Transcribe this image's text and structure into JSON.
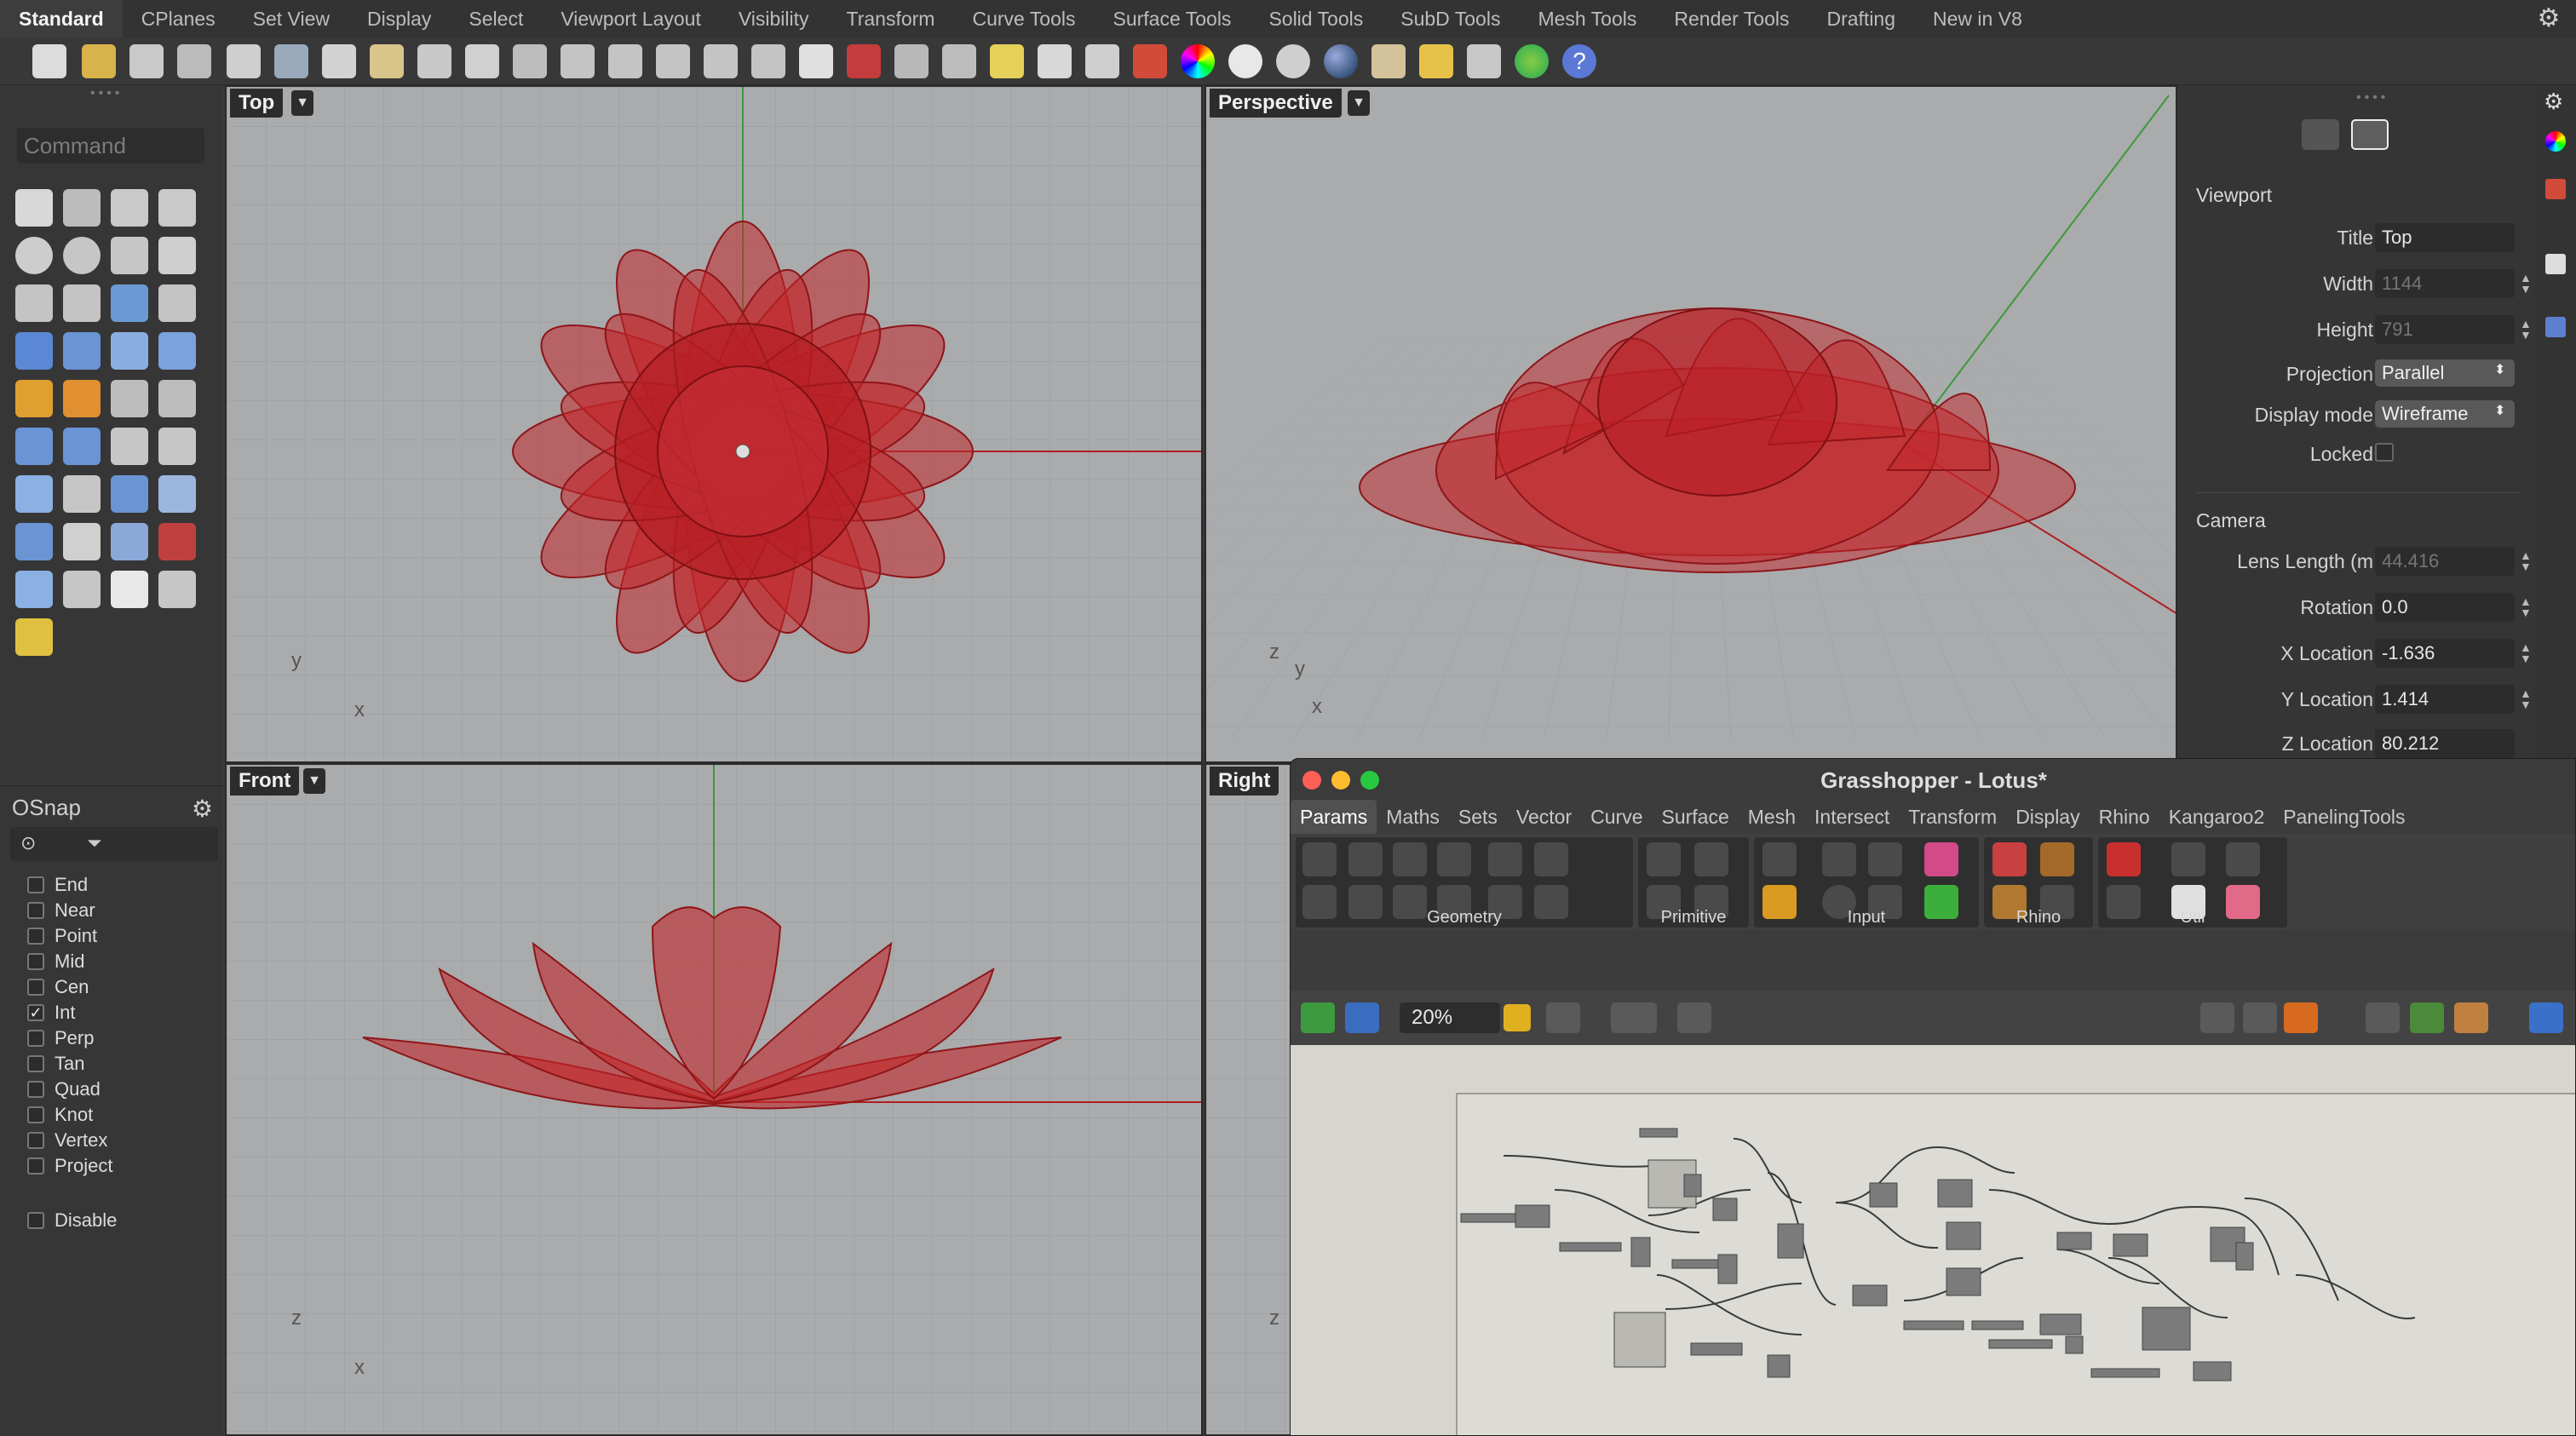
{
  "menu_tabs": [
    "Standard",
    "CPlanes",
    "Set View",
    "Display",
    "Select",
    "Viewport Layout",
    "Visibility",
    "Transform",
    "Curve Tools",
    "Surface Tools",
    "Solid Tools",
    "SubD Tools",
    "Mesh Tools",
    "Render Tools",
    "Drafting",
    "New in V8"
  ],
  "command_placeholder": "Command",
  "viewports": {
    "top": {
      "label": "Top",
      "axis_a": "y",
      "axis_b": "x"
    },
    "perspective": {
      "label": "Perspective",
      "axis_a": "z",
      "axis_b": "y",
      "axis_c": "x"
    },
    "front": {
      "label": "Front",
      "axis_a": "z",
      "axis_b": "x"
    },
    "right": {
      "label": "Right",
      "axis_a": "z"
    }
  },
  "osnap": {
    "title": "OSnap",
    "items": [
      {
        "label": "End",
        "checked": false
      },
      {
        "label": "Near",
        "checked": false
      },
      {
        "label": "Point",
        "checked": false
      },
      {
        "label": "Mid",
        "checked": false
      },
      {
        "label": "Cen",
        "checked": false
      },
      {
        "label": "Int",
        "checked": true
      },
      {
        "label": "Perp",
        "checked": false
      },
      {
        "label": "Tan",
        "checked": false
      },
      {
        "label": "Quad",
        "checked": false
      },
      {
        "label": "Knot",
        "checked": false
      },
      {
        "label": "Vertex",
        "checked": false
      },
      {
        "label": "Project",
        "checked": false
      }
    ],
    "disable_label": "Disable"
  },
  "properties": {
    "viewport_section": "Viewport",
    "title_label": "Title",
    "title_value": "Top",
    "width_label": "Width",
    "width_value": "1144",
    "height_label": "Height",
    "height_value": "791",
    "projection_label": "Projection",
    "projection_value": "Parallel",
    "display_mode_label": "Display mode",
    "display_mode_value": "Wireframe",
    "locked_label": "Locked",
    "camera_section": "Camera",
    "lens_label": "Lens Length (m",
    "lens_value": "44.416",
    "rotation_label": "Rotation",
    "rotation_value": "0.0",
    "xloc_label": "X Location",
    "xloc_value": "-1.636",
    "yloc_label": "Y Location",
    "yloc_value": "1.414",
    "zloc_label": "Z Location",
    "zloc_value": "80.212"
  },
  "grasshopper": {
    "title": "Grasshopper - Lotus*",
    "tabs": [
      "Params",
      "Maths",
      "Sets",
      "Vector",
      "Curve",
      "Surface",
      "Mesh",
      "Intersect",
      "Transform",
      "Display",
      "Rhino",
      "Kangaroo2",
      "PanelingTools"
    ],
    "groups": [
      "Geometry",
      "Primitive",
      "Input",
      "Rhino",
      "Util"
    ],
    "zoom": "20%"
  },
  "colors": {
    "flower": "#b81c1c",
    "accent_gh_tab": "#505050",
    "viewport_bg": "#a9abad",
    "gh_canvas": "#d6d5cf"
  }
}
